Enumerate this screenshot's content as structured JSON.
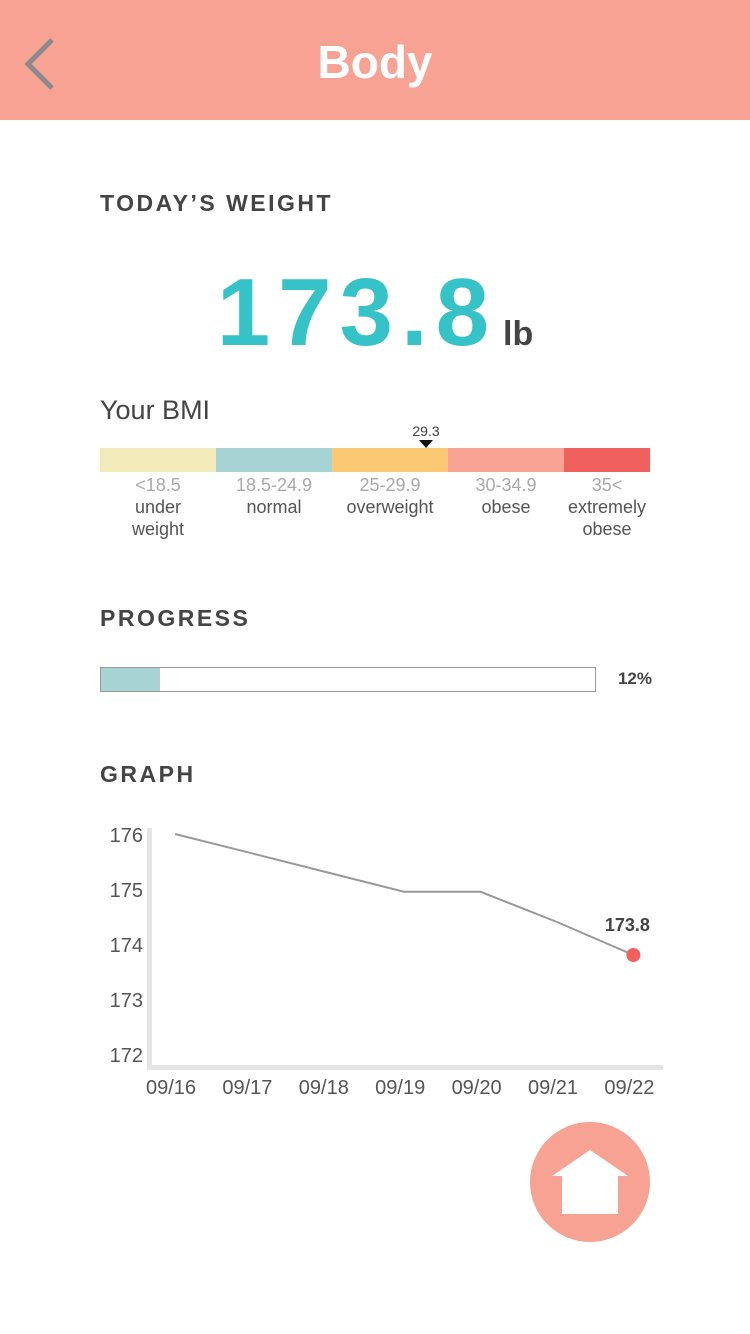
{
  "header": {
    "title": "Body",
    "back_icon": "chevron-left-icon",
    "background_color": "#f7a293"
  },
  "today_weight": {
    "label": "TODAY’S WEIGHT",
    "value": "173.8",
    "unit": "lb",
    "value_color": "#35c3c8"
  },
  "bmi": {
    "title": "Your BMI",
    "value": 29.3,
    "value_label": "29.3",
    "categories": [
      {
        "range": "<18.5",
        "name": "under\nweight",
        "color": "#f2ebb9"
      },
      {
        "range": "18.5-24.9",
        "name": "normal",
        "color": "#a8d3d4"
      },
      {
        "range": "25-29.9",
        "name": "overweight",
        "color": "#fdc874"
      },
      {
        "range": "30-34.9",
        "name": "obese",
        "color": "#f7a293"
      },
      {
        "range": "35<",
        "name": "extremely\nobese",
        "color": "#f0605f"
      }
    ]
  },
  "progress": {
    "label": "PROGRESS",
    "percent": 12,
    "percent_label": "12%",
    "fill_color": "#a8d3d4"
  },
  "graph": {
    "label": "GRAPH"
  },
  "chart_data": {
    "type": "line",
    "x": [
      "09/16",
      "09/17",
      "09/18",
      "09/19",
      "09/20",
      "09/21",
      "09/22"
    ],
    "y_ticks": [
      "176",
      "175",
      "174",
      "173",
      "172"
    ],
    "ylim": [
      172,
      176
    ],
    "series": [
      {
        "values": [
          176,
          175.65,
          175.3,
          174.95,
          174.95,
          174.4,
          173.8
        ]
      }
    ],
    "highlight": {
      "x": "09/22",
      "value": 173.8,
      "label": "173.8",
      "color": "#f0605f"
    },
    "line_color": "#999999",
    "grid": false
  },
  "home_button": {
    "icon": "home-icon",
    "color": "#f7a293"
  }
}
